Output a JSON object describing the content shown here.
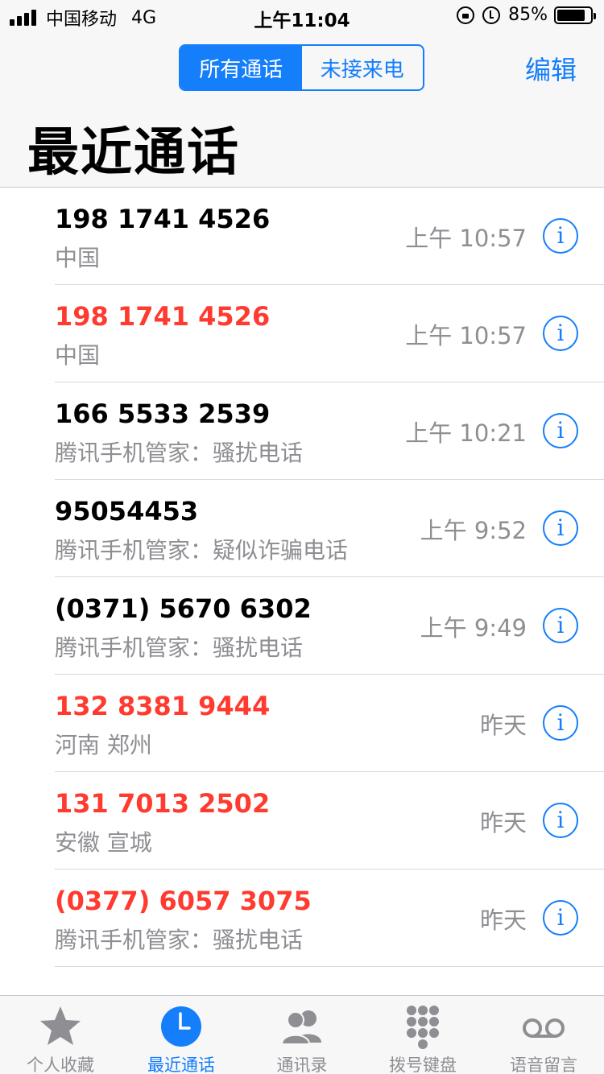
{
  "status": {
    "carrier": "中国移动",
    "network": "4G",
    "time": "上午11:04",
    "battery_text": "85%",
    "battery_level": 0.85
  },
  "header": {
    "segments": [
      "所有通话",
      "未接来电"
    ],
    "edit_label": "编辑",
    "title": "最近通话"
  },
  "calls": [
    {
      "number": "198 1741 4526",
      "sub": "中国",
      "time": "上午 10:57",
      "missed": false
    },
    {
      "number": "198 1741 4526",
      "sub": "中国",
      "time": "上午 10:57",
      "missed": true
    },
    {
      "number": "166 5533 2539",
      "sub": "腾讯手机管家：骚扰电话",
      "time": "上午 10:21",
      "missed": false
    },
    {
      "number": "95054453",
      "sub": "腾讯手机管家：疑似诈骗电话",
      "time": "上午 9:52",
      "missed": false
    },
    {
      "number": "(0371) 5670 6302",
      "sub": "腾讯手机管家：骚扰电话",
      "time": "上午 9:49",
      "missed": false
    },
    {
      "number": "132 8381 9444",
      "sub": "河南 郑州",
      "time": "昨天",
      "missed": true
    },
    {
      "number": "131 7013 2502",
      "sub": "安徽 宣城",
      "time": "昨天",
      "missed": true
    },
    {
      "number": "(0377) 6057 3075",
      "sub": "腾讯手机管家：骚扰电话",
      "time": "昨天",
      "missed": true
    }
  ],
  "tabs": [
    {
      "label": "个人收藏",
      "icon": "star-icon",
      "active": false
    },
    {
      "label": "最近通话",
      "icon": "clock-icon",
      "active": true
    },
    {
      "label": "通讯录",
      "icon": "contacts-icon",
      "active": false
    },
    {
      "label": "拨号键盘",
      "icon": "keypad-icon",
      "active": false
    },
    {
      "label": "语音留言",
      "icon": "voicemail-icon",
      "active": false
    }
  ],
  "colors": {
    "accent": "#147efb",
    "missed": "#ff3b30",
    "secondary": "#8e8e93"
  }
}
